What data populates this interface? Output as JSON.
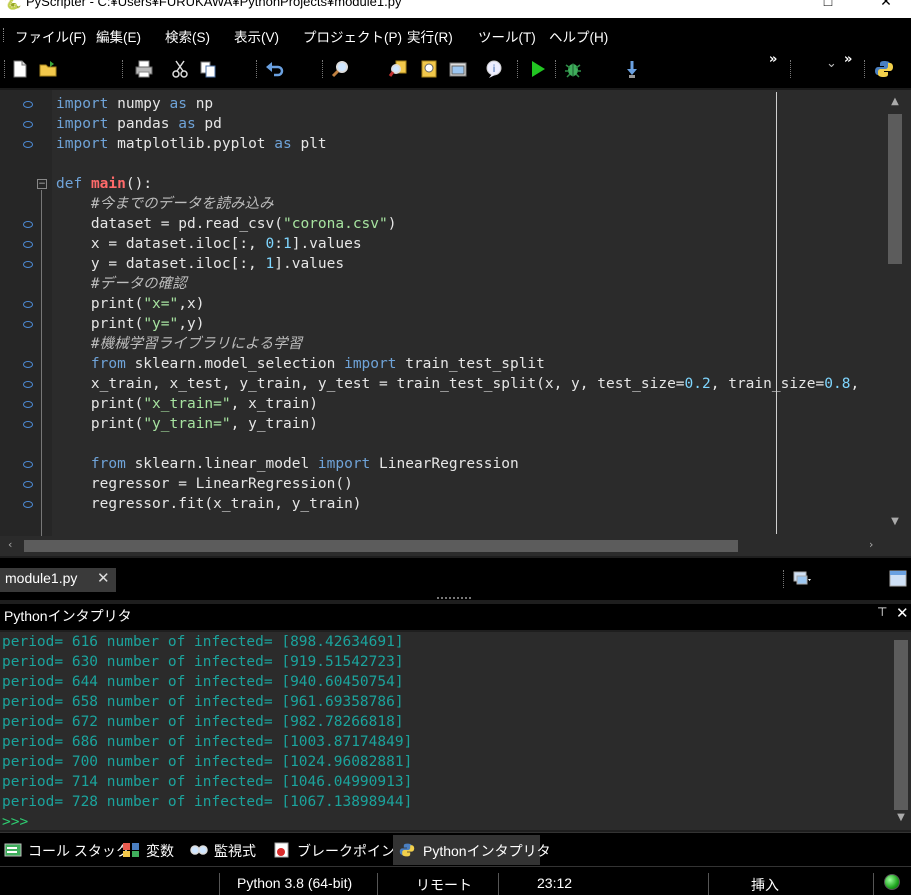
{
  "window": {
    "title": "PyScripter - C:¥Users¥FURUKAWA¥PythonProjects¥module1.py",
    "minimize_glyph": "—",
    "maximize_glyph": "□",
    "close_glyph": "✕"
  },
  "menu": {
    "items": [
      "ファイル(F)",
      "編集(E)",
      "検索(S)",
      "表示(V)",
      "プロジェクト(P)",
      "実行(R)",
      "ツール(T)",
      "ヘルプ(H)"
    ]
  },
  "toolbar": {
    "overflow_glyph": "»",
    "dropdown_glyph": "⌄",
    "icons": [
      "new-file-icon",
      "open-folder-icon",
      "print-icon",
      "cut-icon",
      "copy-icon",
      "undo-icon",
      "search-icon",
      "find-in-files-icon",
      "replace-icon",
      "screenshot-icon",
      "comment-icon",
      "run-icon",
      "debug-icon",
      "step-into-icon",
      "python-icon"
    ]
  },
  "editor": {
    "lines": [
      [
        {
          "t": "import",
          "c": "kw"
        },
        {
          "t": " numpy "
        },
        {
          "t": "as",
          "c": "kw"
        },
        {
          "t": " np"
        }
      ],
      [
        {
          "t": "import",
          "c": "kw"
        },
        {
          "t": " pandas "
        },
        {
          "t": "as",
          "c": "kw"
        },
        {
          "t": " pd"
        }
      ],
      [
        {
          "t": "import",
          "c": "kw"
        },
        {
          "t": " matplotlib.pyplot "
        },
        {
          "t": "as",
          "c": "kw"
        },
        {
          "t": " plt"
        }
      ],
      [],
      [
        {
          "t": "def",
          "c": "kw"
        },
        {
          "t": " "
        },
        {
          "t": "main",
          "c": "fn"
        },
        {
          "t": "():"
        }
      ],
      [
        {
          "t": "    #今までのデータを読み込み",
          "c": "cmt"
        }
      ],
      [
        {
          "t": "    dataset = pd.read_csv("
        },
        {
          "t": "\"corona.csv\"",
          "c": "str"
        },
        {
          "t": ")"
        }
      ],
      [
        {
          "t": "    x = dataset.iloc[:, "
        },
        {
          "t": "0",
          "c": "num"
        },
        {
          "t": ":"
        },
        {
          "t": "1",
          "c": "num"
        },
        {
          "t": "].values"
        }
      ],
      [
        {
          "t": "    y = dataset.iloc[:, "
        },
        {
          "t": "1",
          "c": "num"
        },
        {
          "t": "].values"
        }
      ],
      [
        {
          "t": "    #データの確認",
          "c": "cmt"
        }
      ],
      [
        {
          "t": "    print("
        },
        {
          "t": "\"x=\"",
          "c": "str"
        },
        {
          "t": ",x)"
        }
      ],
      [
        {
          "t": "    print("
        },
        {
          "t": "\"y=\"",
          "c": "str"
        },
        {
          "t": ",y)"
        }
      ],
      [
        {
          "t": "    #機械学習ライブラリによる学習",
          "c": "cmt"
        }
      ],
      [
        {
          "t": "    "
        },
        {
          "t": "from",
          "c": "kw"
        },
        {
          "t": " sklearn.model_selection "
        },
        {
          "t": "import",
          "c": "kw"
        },
        {
          "t": " train_test_split"
        }
      ],
      [
        {
          "t": "    x_train, x_test, y_train, y_test = train_test_split(x, y, test_size="
        },
        {
          "t": "0.2",
          "c": "num"
        },
        {
          "t": ", train_size="
        },
        {
          "t": "0.8",
          "c": "num"
        },
        {
          "t": ","
        }
      ],
      [
        {
          "t": "    print("
        },
        {
          "t": "\"x_train=\"",
          "c": "str"
        },
        {
          "t": ", x_train)"
        }
      ],
      [
        {
          "t": "    print("
        },
        {
          "t": "\"y_train=\"",
          "c": "str"
        },
        {
          "t": ", y_train)"
        }
      ],
      [],
      [
        {
          "t": "    "
        },
        {
          "t": "from",
          "c": "kw"
        },
        {
          "t": " sklearn.linear_model "
        },
        {
          "t": "import",
          "c": "kw"
        },
        {
          "t": " LinearRegression"
        }
      ],
      [
        {
          "t": "    regressor = LinearRegression()"
        }
      ],
      [
        {
          "t": "    regressor.fit(x_train, y_train)"
        }
      ]
    ],
    "marker_lines": [
      0,
      1,
      2,
      6,
      7,
      8,
      10,
      11,
      13,
      14,
      15,
      16,
      18,
      19,
      20
    ],
    "fold_line": 4
  },
  "tabs": {
    "file_tab_label": "module1.py",
    "file_tab_close": "✕"
  },
  "interpreter": {
    "title": "Pythonインタプリタ",
    "pin_glyph": "📌",
    "close_glyph": "✕",
    "output_lines": [
      "period= 616 number of infected= [898.42634691]",
      "period= 630 number of infected= [919.51542723]",
      "period= 644 number of infected= [940.60450754]",
      "period= 658 number of infected= [961.69358786]",
      "period= 672 number of infected= [982.78266818]",
      "period= 686 number of infected= [1003.87174849]",
      "period= 700 number of infected= [1024.96082881]",
      "period= 714 number of infected= [1046.04990913]",
      "period= 728 number of infected= [1067.13898944]"
    ],
    "prompt": ">>>"
  },
  "bottom_tabs": [
    {
      "label": "コール スタック",
      "icon": "call-stack-icon"
    },
    {
      "label": "変数",
      "icon": "variables-icon"
    },
    {
      "label": "監視式",
      "icon": "watches-icon"
    },
    {
      "label": "ブレークポイント",
      "icon": "breakpoints-icon"
    },
    {
      "label": "Pythonインタプリタ",
      "icon": "python-icon"
    }
  ],
  "status": {
    "python_version": "Python 3.8 (64-bit)",
    "mode": "リモート",
    "position": "23:12",
    "insert_mode": "挿入"
  }
}
